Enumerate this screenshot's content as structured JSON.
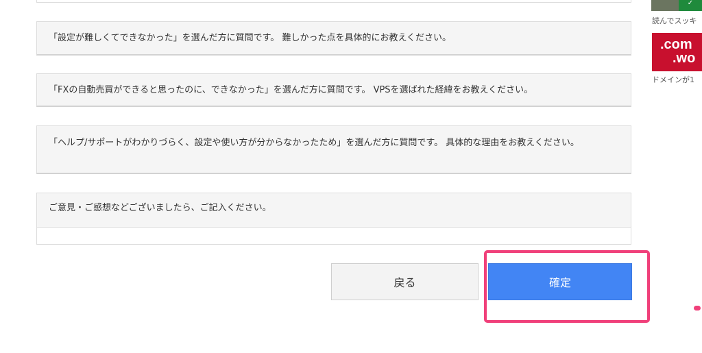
{
  "questions": [
    {
      "text": "「設定が難しくてできなかった」を選んだ方に質問です。 難しかった点を具体的にお教えください。"
    },
    {
      "text": "「FXの自動売買ができると思ったのに、できなかった」を選んだ方に質問です。 VPSを選ばれた経緯をお教えください。"
    },
    {
      "text": "「ヘルプ/サポートがわかりづらく、設定や使い方が分からなかったため」を選んだ方に質問です。 具体的な理由をお教えください。"
    },
    {
      "text": "ご意見・ご感想などございましたら、ご記入ください。"
    }
  ],
  "buttons": {
    "back_label": "戻る",
    "confirm_label": "確定"
  },
  "sidebar": {
    "thumb_caption": "読んでスッキ",
    "ad_line1": ".com",
    "ad_line2": ".wo",
    "ad_caption": "ドメインが1"
  },
  "colors": {
    "confirm_button": "#4285f4",
    "highlight": "#f0407a",
    "ad_background": "#c8102e"
  }
}
